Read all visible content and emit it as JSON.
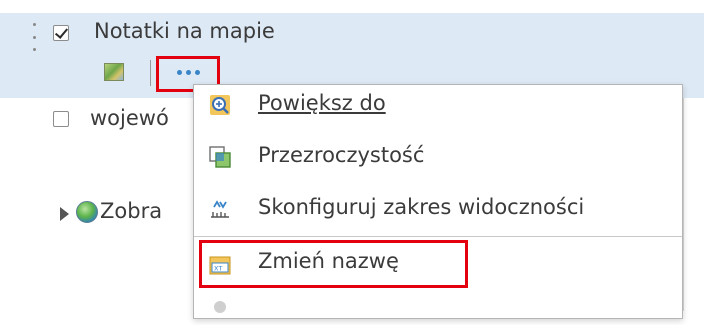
{
  "layers": [
    {
      "label": "Notatki na mapie",
      "checked": true,
      "selected": true
    },
    {
      "label": "wojewó",
      "checked": false
    },
    {
      "label": "Zobra",
      "expandable": true
    }
  ],
  "layer_actions": {
    "more_button": "more-options-icon"
  },
  "context_menu": {
    "items": [
      {
        "label": "Powiększ do",
        "icon": "zoom-to-icon",
        "link": true
      },
      {
        "label": "Przezroczystość",
        "icon": "transparency-icon"
      },
      {
        "label": "Skonfiguruj zakres widoczności",
        "icon": "visibility-range-icon"
      },
      {
        "label": "Zmień nazwę",
        "icon": "rename-icon"
      }
    ]
  },
  "highlight_color": "#e3000f",
  "accent_color": "#3a85c8"
}
